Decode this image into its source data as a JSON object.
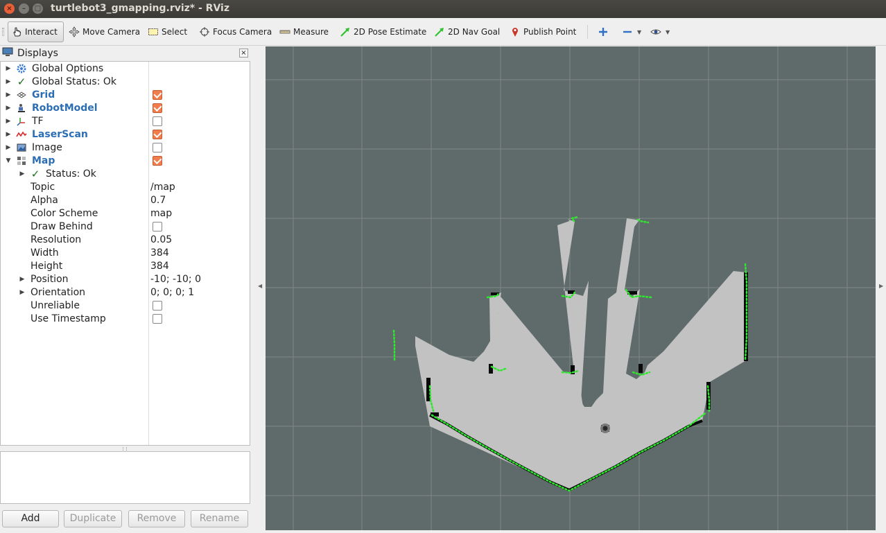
{
  "window": {
    "title": "turtlebot3_gmapping.rviz* - RViz",
    "close": "×",
    "minimize": "–",
    "maximize": "□"
  },
  "toolbar": {
    "interact": "Interact",
    "move_camera": "Move Camera",
    "select": "Select",
    "focus_camera": "Focus Camera",
    "measure": "Measure",
    "pose_estimate": "2D Pose Estimate",
    "nav_goal": "2D Nav Goal",
    "publish_point": "Publish Point"
  },
  "displays": {
    "title": "Displays",
    "close": "×",
    "items": [
      {
        "label": "Global Options"
      },
      {
        "label": "Global Status: Ok"
      },
      {
        "label": "Grid",
        "checked": true
      },
      {
        "label": "RobotModel",
        "checked": true
      },
      {
        "label": "TF",
        "checked": false
      },
      {
        "label": "LaserScan",
        "checked": true
      },
      {
        "label": "Image",
        "checked": false
      },
      {
        "label": "Map",
        "checked": true
      }
    ],
    "map_props": {
      "status": "Status: Ok",
      "topic_label": "Topic",
      "topic": "/map",
      "alpha_label": "Alpha",
      "alpha": "0.7",
      "color_scheme_label": "Color Scheme",
      "color_scheme": "map",
      "draw_behind_label": "Draw Behind",
      "resolution_label": "Resolution",
      "resolution": "0.05",
      "width_label": "Width",
      "width": "384",
      "height_label": "Height",
      "height": "384",
      "position_label": "Position",
      "position": "-10; -10; 0",
      "orientation_label": "Orientation",
      "orientation": "0; 0; 0; 1",
      "unreliable_label": "Unreliable",
      "use_timestamp_label": "Use Timestamp"
    }
  },
  "buttons": {
    "add": "Add",
    "duplicate": "Duplicate",
    "remove": "Remove",
    "rename": "Rename"
  },
  "colors": {
    "accent_blue": "#2c6eb5",
    "checkbox_on": "#ef7d4e",
    "view_bg": "#5f6b6a",
    "map_free": "#c2c2c2",
    "laser": "#22ee22"
  }
}
